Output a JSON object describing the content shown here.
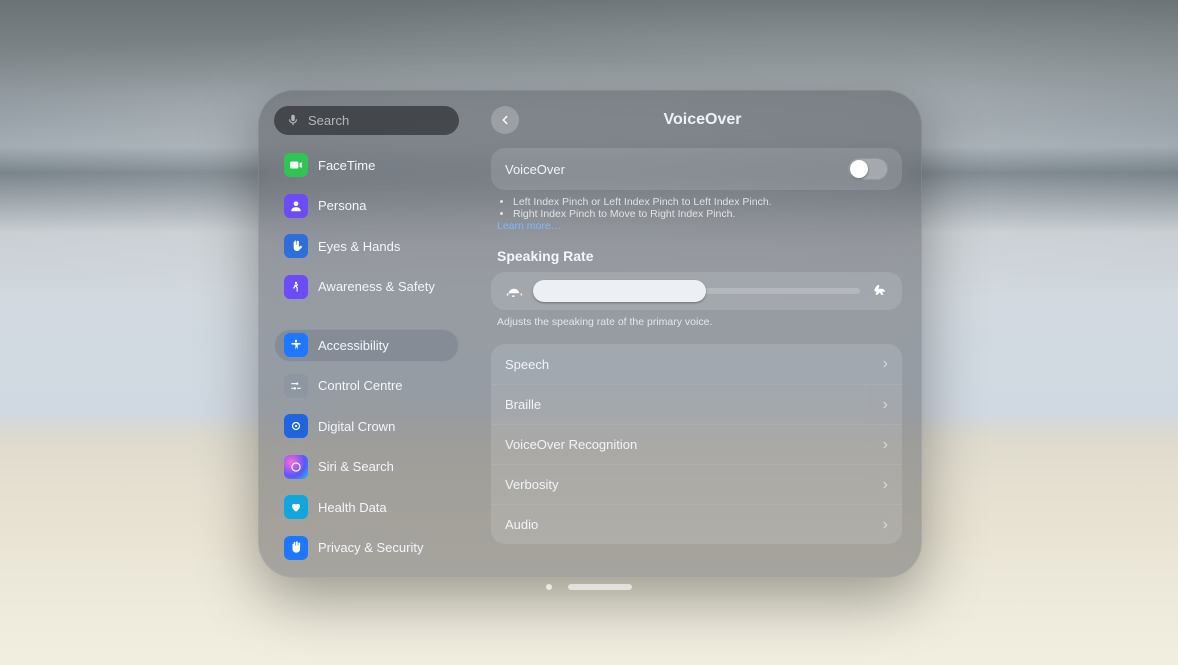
{
  "search": {
    "placeholder": "Search",
    "value": ""
  },
  "sidebar": {
    "items": [
      {
        "id": "facetime",
        "label": "FaceTime"
      },
      {
        "id": "persona",
        "label": "Persona"
      },
      {
        "id": "eyes",
        "label": "Eyes & Hands"
      },
      {
        "id": "awareness",
        "label": "Awareness & Safety"
      },
      {
        "id": "access",
        "label": "Accessibility"
      },
      {
        "id": "control",
        "label": "Control Centre"
      },
      {
        "id": "crown",
        "label": "Digital Crown"
      },
      {
        "id": "siri",
        "label": "Siri & Search"
      },
      {
        "id": "health",
        "label": "Health Data"
      },
      {
        "id": "privacy",
        "label": "Privacy & Security"
      }
    ],
    "active_index": 4
  },
  "detail": {
    "title": "VoiceOver",
    "voiceover_toggle": {
      "label": "VoiceOver",
      "on": false
    },
    "help": {
      "bullets": [
        "Left Index Pinch or Left Index Pinch to Left Index Pinch.",
        "Right Index Pinch to Move to Right Index Pinch."
      ],
      "learn_more": "Learn more…"
    },
    "speaking_rate": {
      "title": "Speaking Rate",
      "value_percent": 53,
      "caption": "Adjusts the speaking rate of the primary voice."
    },
    "rows": [
      {
        "id": "speech",
        "label": "Speech"
      },
      {
        "id": "braille",
        "label": "Braille"
      },
      {
        "id": "recog",
        "label": "VoiceOver Recognition"
      },
      {
        "id": "verbosity",
        "label": "Verbosity"
      },
      {
        "id": "audio",
        "label": "Audio"
      }
    ]
  }
}
